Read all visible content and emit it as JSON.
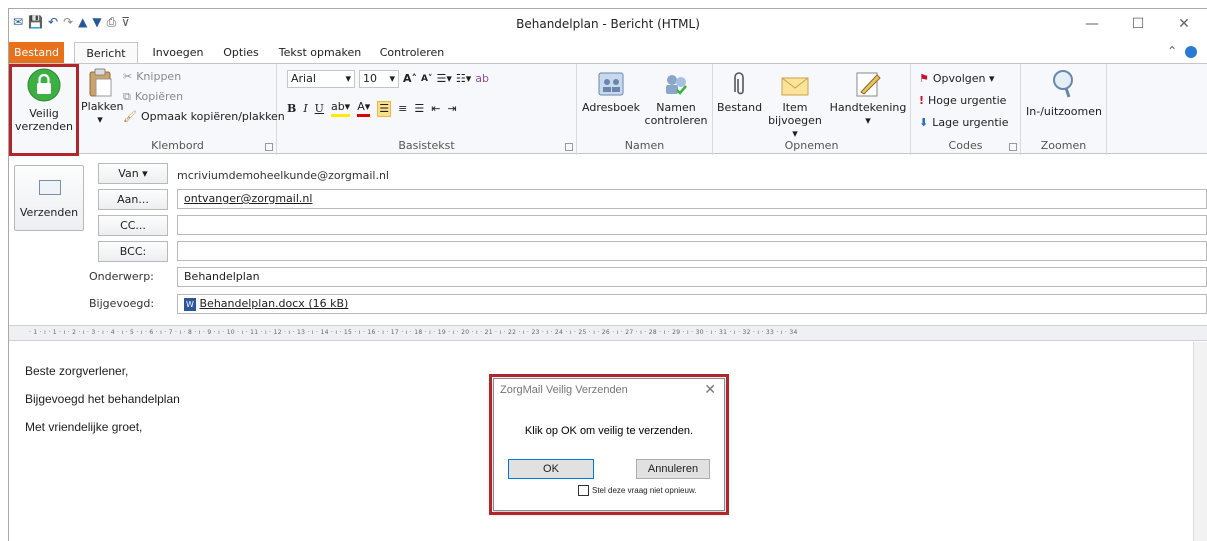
{
  "window": {
    "title": "Behandelplan - Bericht (HTML)"
  },
  "tabs": [
    "Bestand",
    "Bericht",
    "Invoegen",
    "Opties",
    "Tekst opmaken",
    "Controleren"
  ],
  "ribbon": {
    "secure": {
      "label1": "Veilig",
      "label2": "verzenden"
    },
    "clipboard": {
      "paste": "Plakken",
      "cut": "Knippen",
      "copy": "Kopiëren",
      "format_painter": "Opmaak kopiëren/plakken",
      "group": "Klembord"
    },
    "font": {
      "name": "Arial",
      "size": "10",
      "group": "Basistekst"
    },
    "names": {
      "address_book": "Adresboek",
      "check1": "Namen",
      "check2": "controleren",
      "group": "Namen"
    },
    "include": {
      "file": "Bestand",
      "item1": "Item",
      "item2": "bijvoegen ▾",
      "signature": "Handtekening",
      "group": "Opnemen"
    },
    "tags": {
      "follow": "Opvolgen ▾",
      "high": "Hoge urgentie",
      "low": "Lage urgentie",
      "group": "Codes"
    },
    "zoom": {
      "label": "In-/uitzoomen",
      "group": "Zoomen"
    }
  },
  "header": {
    "send": "Verzenden",
    "from_btn": "Van ▾",
    "from_value": "mcriviumdemoheelkunde@zorgmail.nl",
    "to_btn": "Aan...",
    "to_value": "ontvanger@zorgmail.nl",
    "cc_btn": "CC...",
    "bcc_btn": "BCC:",
    "subject_label": "Onderwerp:",
    "subject_value": "Behandelplan",
    "attached_label": "Bijgevoegd:",
    "attachment": "Behandelplan.docx (16 kB)"
  },
  "ruler": "· 1 · ı · 1 · ı · 2 · ı · 3 · ı · 4 · ı · 5 · ı · 6 · ı · 7 · ı · 8 · ı · 9 · ı · 10 · ı · 11 · ı · 12 · ı · 13 · ı · 14 · ı · 15 · ı · 16 · ı · 17 · ı · 18 · ı · 19 · ı · 20 · ı · 21 · ı · 22 · ı · 23 · ı · 24 · ı · 25 · ı · 26 · ı · 27 · ı · 28 · ı · 29 · ı · 30 · ı · 31 · ı · 32 · ı · 33 · ı · 34",
  "body": {
    "line1": "Beste zorgverlener,",
    "line2": "Bijgevoegd het behandelplan",
    "line3": "Met vriendelijke groet,"
  },
  "dialog": {
    "title": "ZorgMail Veilig Verzenden",
    "message": "Klik op OK om veilig te verzenden.",
    "ok": "OK",
    "cancel": "Annuleren",
    "checkbox": "Stel deze vraag niet opnieuw."
  },
  "colors": {
    "file_tab": "#e8721c",
    "highlight": "#b0262b",
    "lock_green": "#3cb043"
  }
}
